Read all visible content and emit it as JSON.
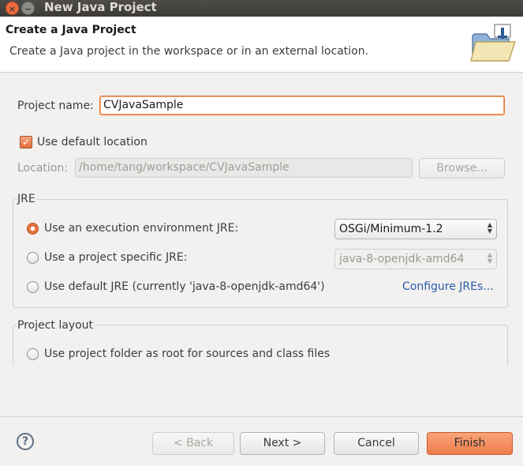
{
  "window": {
    "title": "New Java Project",
    "close_glyph": "×",
    "minimize_glyph": "−"
  },
  "header": {
    "title": "Create a Java Project",
    "description": "Create a Java project in the workspace or in an external location.",
    "icon": "java-project-folder-icon"
  },
  "project_name": {
    "label": "Project name:",
    "value": "CVJavaSample"
  },
  "default_location": {
    "label": "Use default location",
    "checked": true,
    "check_glyph": "✓"
  },
  "location": {
    "label": "Location:",
    "value": "/home/tang/workspace/CVJavaSample",
    "browse_label": "Browse..."
  },
  "jre": {
    "legend": "JRE",
    "options": [
      {
        "label": "Use an execution environment JRE:",
        "selected": true,
        "select_value": "OSGi/Minimum-1.2"
      },
      {
        "label": "Use a project specific JRE:",
        "selected": false,
        "select_value": "java-8-openjdk-amd64"
      },
      {
        "label": "Use default JRE (currently 'java-8-openjdk-amd64')",
        "selected": false
      }
    ],
    "configure_link": "Configure JREs..."
  },
  "project_layout": {
    "legend": "Project layout",
    "options": [
      {
        "label": "Use project folder as root for sources and class files",
        "selected": false
      }
    ]
  },
  "footer": {
    "help_glyph": "?",
    "back_label": "< Back",
    "next_label": "Next >",
    "cancel_label": "Cancel",
    "finish_label": "Finish"
  },
  "colors": {
    "accent": "#e8733d",
    "link": "#2a5aa7",
    "focus_border": "#e5772f"
  }
}
